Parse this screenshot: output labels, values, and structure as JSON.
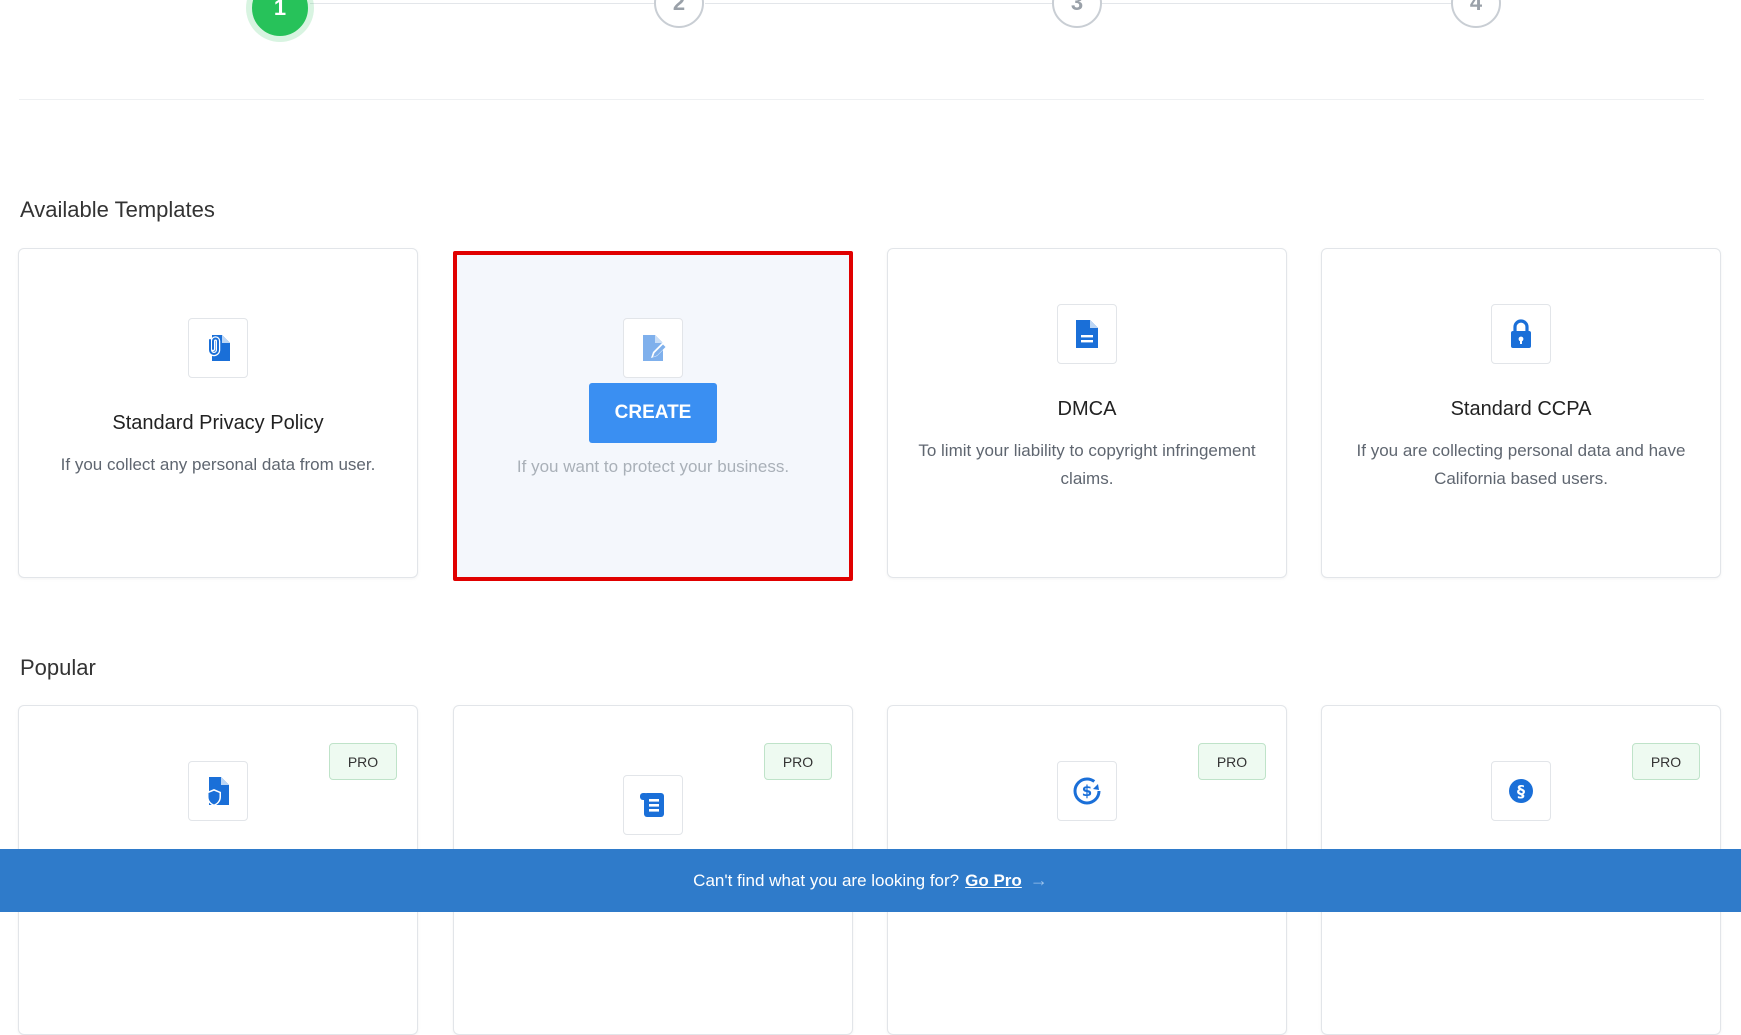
{
  "stepper": {
    "steps": [
      {
        "label": "1",
        "active": true
      },
      {
        "label": "2",
        "active": false
      },
      {
        "label": "3",
        "active": false
      },
      {
        "label": "4",
        "active": false
      }
    ]
  },
  "available": {
    "title": "Available Templates",
    "cards": [
      {
        "title": "Standard Privacy Policy",
        "desc": "If you collect any personal data from user.",
        "icon": "privacy-document-icon"
      },
      {
        "title": "",
        "desc": "If you want to protect your business.",
        "icon": "edit-document-icon",
        "button": "CREATE"
      },
      {
        "title": "DMCA",
        "desc": "To limit your liability to copyright infringement claims.",
        "icon": "file-text-icon"
      },
      {
        "title": "Standard CCPA",
        "desc": "If you are collecting personal data and have California based users.",
        "icon": "lock-icon"
      }
    ]
  },
  "popular": {
    "title": "Popular",
    "badge": "PRO",
    "cards": [
      {
        "icon": "shield-document-icon"
      },
      {
        "icon": "scroll-icon"
      },
      {
        "icon": "refund-dollar-icon"
      },
      {
        "icon": "section-sign-icon"
      }
    ]
  },
  "footer": {
    "text": "Can't find what you are looking for?",
    "link": "Go Pro",
    "arrow": "→"
  },
  "colors": {
    "accent": "#3a8ff2",
    "icon_blue": "#1a6fd8",
    "active_step": "#27c25a",
    "footer_bg": "#2f7bca",
    "highlight_border": "#e00000"
  }
}
